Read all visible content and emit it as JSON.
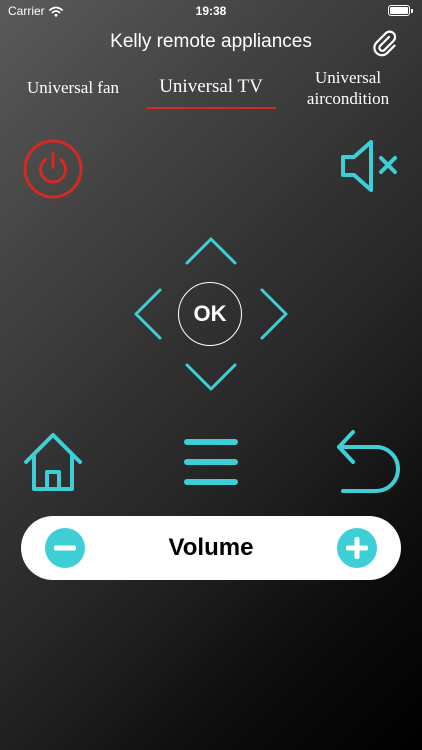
{
  "status_bar": {
    "carrier": "Carrier",
    "time": "19:38"
  },
  "header": {
    "title": "Kelly remote appliances",
    "attach_icon": "paperclip-icon"
  },
  "tabs": [
    {
      "label": "Universal fan",
      "selected": false
    },
    {
      "label": "Universal TV",
      "selected": true
    },
    {
      "label": "Universal aircondition",
      "selected": false
    }
  ],
  "remote": {
    "ok_label": "OK",
    "icons": {
      "power": "power-icon",
      "mute": "speaker-mute-icon",
      "up": "chevron-up-icon",
      "down": "chevron-down-icon",
      "left": "chevron-left-icon",
      "right": "chevron-right-icon",
      "home": "home-icon",
      "menu": "menu-icon",
      "back": "back-arrow-icon"
    }
  },
  "volume": {
    "label": "Volume",
    "decrease_icon": "minus-circle-icon",
    "increase_icon": "plus-circle-icon"
  },
  "colors": {
    "accent": "#3ecfd6",
    "power": "#d42a1f",
    "tab_underline": "#d42a1f",
    "volume_bar": "#ffffff"
  }
}
